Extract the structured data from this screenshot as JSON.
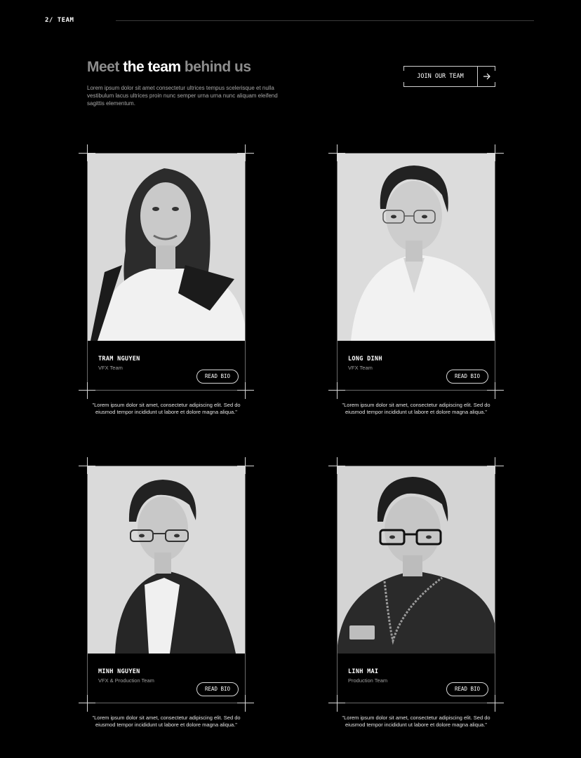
{
  "section_label": "2/ TEAM",
  "heading": {
    "part1": "Meet ",
    "part2": "the team",
    "part3": " behind us"
  },
  "intro": "Lorem ipsum dolor sit amet consectetur ultrices tempus scelerisque et nulla vestibulum lacus ultrices proin nunc semper urna urna nunc aliquam eleifend sagittis elementum.",
  "join_button": {
    "label": "JOIN OUR TEAM",
    "icon": "arrow-right-icon"
  },
  "colors": {
    "background": "#000000",
    "text": "#ffffff",
    "muted": "#8d8d8d",
    "frame": "#6a6a6a"
  },
  "team": [
    {
      "name": "TRAM NGUYEN",
      "role": "VFX Team",
      "button": "READ BIO",
      "quote": "\"Lorem ipsum dolor sit amet, consectetur adipiscing elit. Sed do eiusmod tempor incididunt ut labore et dolore magna aliqua.\""
    },
    {
      "name": "LONG DINH",
      "role": "VFX Team",
      "button": "READ BIO",
      "quote": "\"Lorem ipsum dolor sit amet, consectetur adipiscing elit. Sed do eiusmod tempor incididunt ut labore et dolore magna aliqua.\""
    },
    {
      "name": "MINH NGUYEN",
      "role": "VFX & Production Team",
      "button": "READ BIO",
      "quote": "\"Lorem ipsum dolor sit amet, consectetur adipiscing elit. Sed do eiusmod tempor incididunt ut labore et dolore magna aliqua.\""
    },
    {
      "name": "LINH MAI",
      "role": "Production Team",
      "button": "READ BIO",
      "quote": "\"Lorem ipsum dolor sit amet, consectetur adipiscing elit. Sed do eiusmod tempor incididunt ut labore et dolore magna aliqua.\""
    }
  ]
}
